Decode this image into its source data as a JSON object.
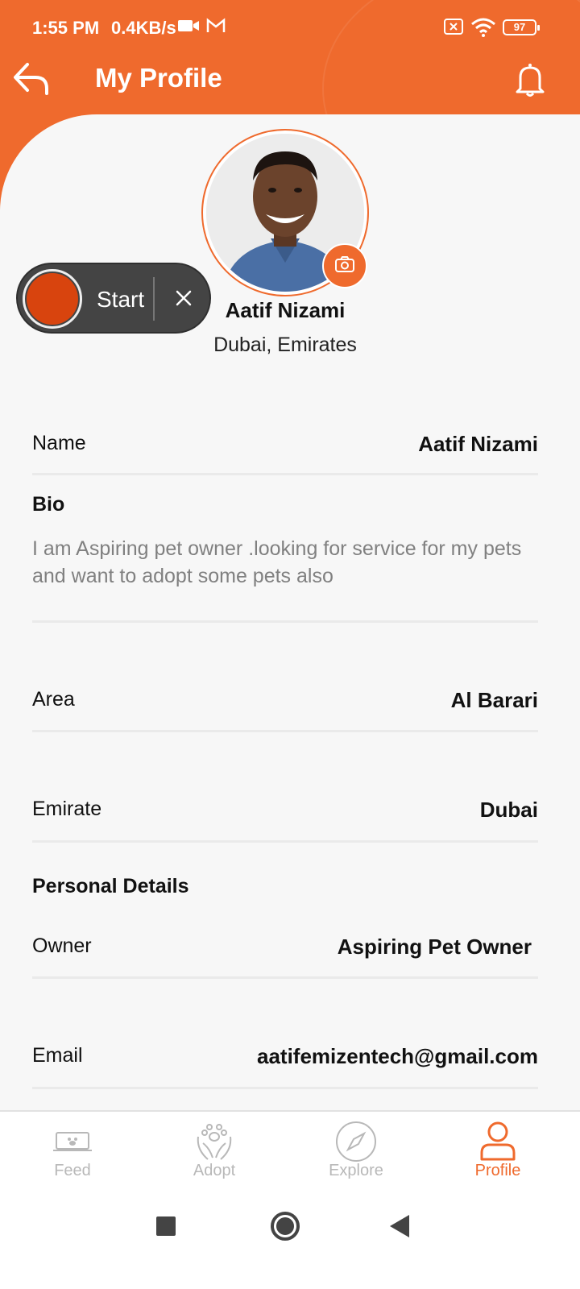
{
  "colors": {
    "accent": "#ef6a2d",
    "record": "#d8440e"
  },
  "status_bar": {
    "time": "1:55 PM",
    "speed": "0.4KB/s",
    "battery": "97",
    "icons": [
      "video-icon",
      "gmail-icon",
      "sim-off-icon",
      "wifi-icon",
      "battery-icon"
    ]
  },
  "header": {
    "title": "My Profile",
    "back_icon": "back-arrow-icon",
    "bell_icon": "bell-icon"
  },
  "profile": {
    "name": "Aatif Nizami",
    "location": "Dubai, Emirates",
    "camera_icon": "camera-icon"
  },
  "recorder": {
    "label": "Start",
    "close_icon": "close-icon"
  },
  "fields": {
    "name": {
      "label": "Name",
      "value": "Aatif Nizami"
    },
    "bio": {
      "label": "Bio",
      "value": "I am Aspiring pet owner .looking for service for my pets and want to adopt some pets also"
    },
    "area": {
      "label": "Area",
      "value": "Al Barari"
    },
    "emirate": {
      "label": "Emirate",
      "value": "Dubai"
    },
    "personal_details": "Personal Details",
    "owner": {
      "label": "Owner",
      "value": "Aspiring Pet Owner"
    },
    "email": {
      "label": "Email",
      "value": "aatifemizentech@gmail.com"
    }
  },
  "bottom_nav": [
    {
      "label": "Feed",
      "icon": "feed-icon",
      "active": false
    },
    {
      "label": "Adopt",
      "icon": "adopt-icon",
      "active": false
    },
    {
      "label": "Explore",
      "icon": "compass-icon",
      "active": false
    },
    {
      "label": "Profile",
      "icon": "profile-icon",
      "active": true
    }
  ]
}
